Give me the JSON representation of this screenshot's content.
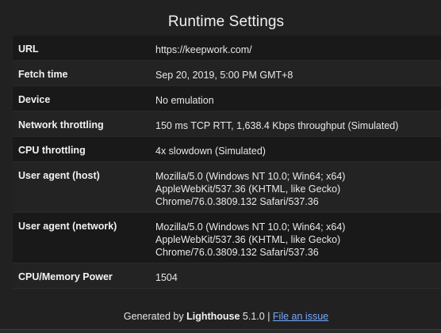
{
  "title": "Runtime Settings",
  "rows": [
    {
      "label": "URL",
      "value": "https://keepwork.com/"
    },
    {
      "label": "Fetch time",
      "value": "Sep 20, 2019, 5:00 PM GMT+8"
    },
    {
      "label": "Device",
      "value": "No emulation"
    },
    {
      "label": "Network throttling",
      "value": "150 ms TCP RTT, 1,638.4 Kbps throughput (Simulated)"
    },
    {
      "label": "CPU throttling",
      "value": "4x slowdown (Simulated)"
    },
    {
      "label": "User agent (host)",
      "lines": [
        "Mozilla/5.0 (Windows NT 10.0; Win64; x64)",
        "AppleWebKit/537.36 (KHTML, like Gecko)",
        "Chrome/76.0.3809.132 Safari/537.36"
      ]
    },
    {
      "label": "User agent (network)",
      "lines": [
        "Mozilla/5.0 (Windows NT 10.0; Win64; x64)",
        "AppleWebKit/537.36 (KHTML, like Gecko)",
        "Chrome/76.0.3809.132 Safari/537.36"
      ]
    },
    {
      "label": "CPU/Memory Power",
      "value": "1504"
    }
  ],
  "footer": {
    "prefix": "Generated by ",
    "brand": "Lighthouse",
    "version": " 5.1.0 | ",
    "link": "File an issue"
  }
}
